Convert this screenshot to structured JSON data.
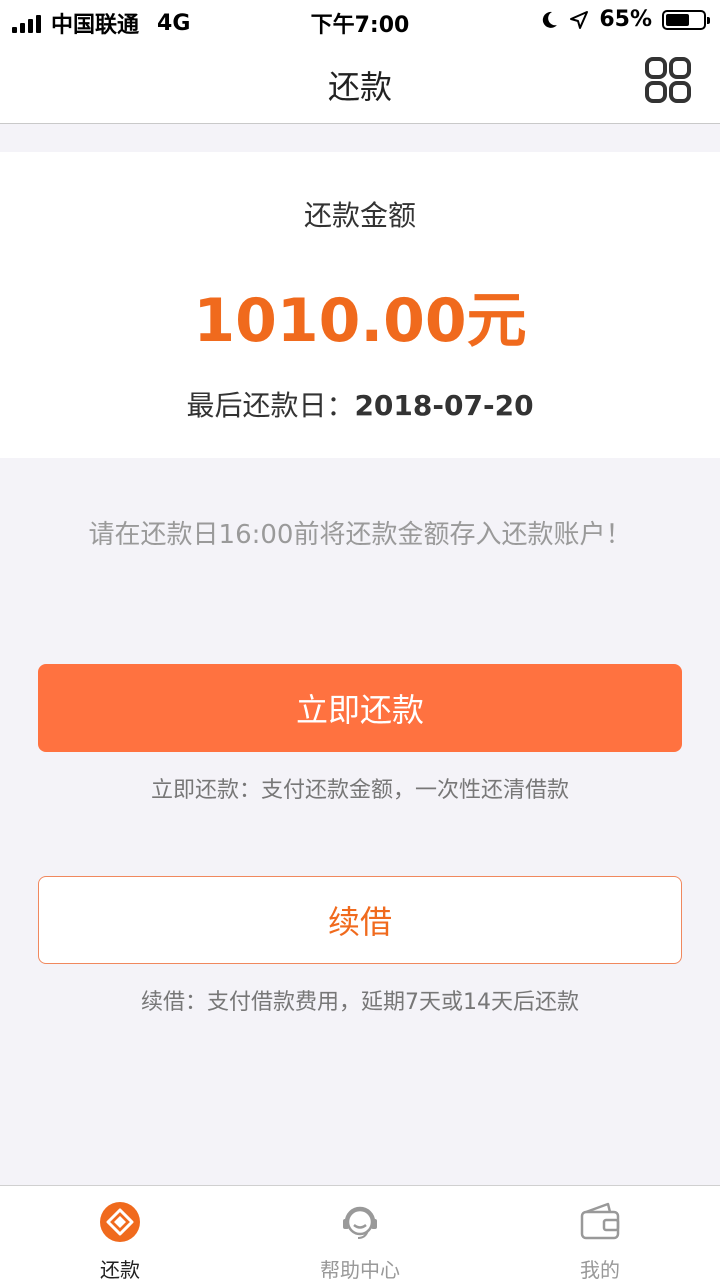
{
  "status_bar": {
    "carrier": "中国联通",
    "network": "4G",
    "time": "下午7:00",
    "battery": "65%",
    "battery_level": 0.65
  },
  "nav": {
    "title": "还款"
  },
  "amount_card": {
    "label": "还款金额",
    "amount": "1010.00元",
    "due_label": "最后还款日：",
    "due_date": "2018-07-20"
  },
  "notice": "请在还款日16:00前将还款金额存入还款账户！",
  "actions": {
    "repay_label": "立即还款",
    "repay_hint": "立即还款：支付还款金额，一次性还清借款",
    "renew_label": "续借",
    "renew_hint": "续借：支付借款费用，延期7天或14天后还款"
  },
  "tabs": [
    {
      "label": "还款",
      "icon": "repay-icon",
      "active": true
    },
    {
      "label": "帮助中心",
      "icon": "headset-icon",
      "active": false
    },
    {
      "label": "我的",
      "icon": "wallet-icon",
      "active": false
    }
  ],
  "colors": {
    "accent": "#f06a1d",
    "primary_button": "#ff7240",
    "background": "#f4f3f8"
  }
}
